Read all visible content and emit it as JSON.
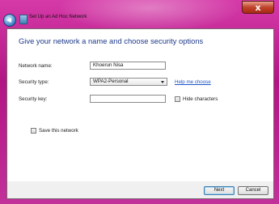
{
  "window": {
    "title": "Set Up an Ad Hoc Network",
    "close_label": "x"
  },
  "page": {
    "heading": "Give your network a name and choose security options"
  },
  "form": {
    "network_name_label": "Network name:",
    "network_name_value": "Khoerun Nisa",
    "security_type_label": "Security type:",
    "security_type_value": "WPA2-Personal",
    "help_link": "Help me choose",
    "security_key_label": "Security key:",
    "security_key_value": "",
    "hide_characters_label": "Hide characters",
    "save_network_label": "Save this network"
  },
  "footer": {
    "next_label": "Next",
    "cancel_label": "Cancel"
  }
}
